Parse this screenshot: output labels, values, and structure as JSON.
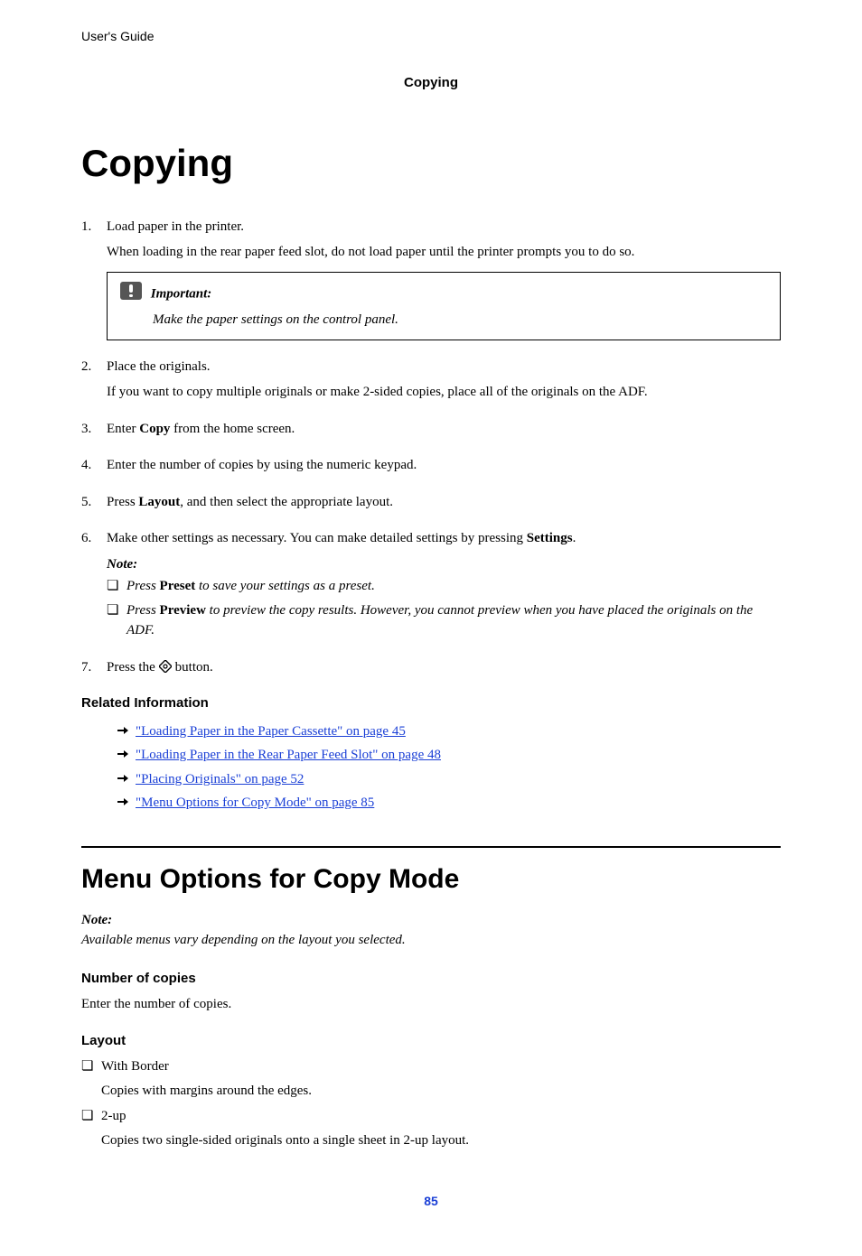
{
  "header": {
    "doc_type": "User's Guide",
    "section": "Copying"
  },
  "title": "Copying",
  "steps": {
    "s1": {
      "main": "Load paper in the printer.",
      "detail": "When loading in the rear paper feed slot, do not load paper until the printer prompts you to do so.",
      "callout_label": "Important:",
      "callout_body": "Make the paper settings on the control panel."
    },
    "s2": {
      "main": "Place the originals.",
      "detail": "If you want to copy multiple originals or make 2-sided copies, place all of the originals on the ADF."
    },
    "s3": {
      "pre": "Enter ",
      "bold": "Copy",
      "post": " from the home screen."
    },
    "s4": {
      "main": "Enter the number of copies by using the numeric keypad."
    },
    "s5": {
      "pre": "Press ",
      "bold": "Layout",
      "post": ", and then select the appropriate layout."
    },
    "s6": {
      "pre": "Make other settings as necessary. You can make detailed settings by pressing ",
      "bold": "Settings",
      "post": ".",
      "note_label": "Note:",
      "note_a_pre": "Press ",
      "note_a_bold": "Preset",
      "note_a_post": " to save your settings as a preset.",
      "note_b_pre": "Press ",
      "note_b_bold": "Preview",
      "note_b_post": " to preview the copy results. However, you cannot preview when you have placed the originals on the ADF."
    },
    "s7": {
      "pre": "Press the ",
      "post": " button."
    }
  },
  "related": {
    "heading": "Related Information",
    "items": [
      "\"Loading Paper in the Paper Cassette\" on page 45",
      "\"Loading Paper in the Rear Paper Feed Slot\" on page 48",
      "\"Placing Originals\" on page 52",
      "\"Menu Options for Copy Mode\" on page 85"
    ]
  },
  "menu": {
    "heading": "Menu Options for Copy Mode",
    "note_label": "Note:",
    "note_body": "Available menus vary depending on the layout you selected.",
    "num_copies_label": "Number of copies",
    "num_copies_body": "Enter the number of copies.",
    "layout_label": "Layout",
    "layout_items": {
      "a_title": "With Border",
      "a_body": "Copies with margins around the edges.",
      "b_title": "2-up",
      "b_body": "Copies two single-sided originals onto a single sheet in 2-up layout."
    }
  },
  "page_number": "85"
}
